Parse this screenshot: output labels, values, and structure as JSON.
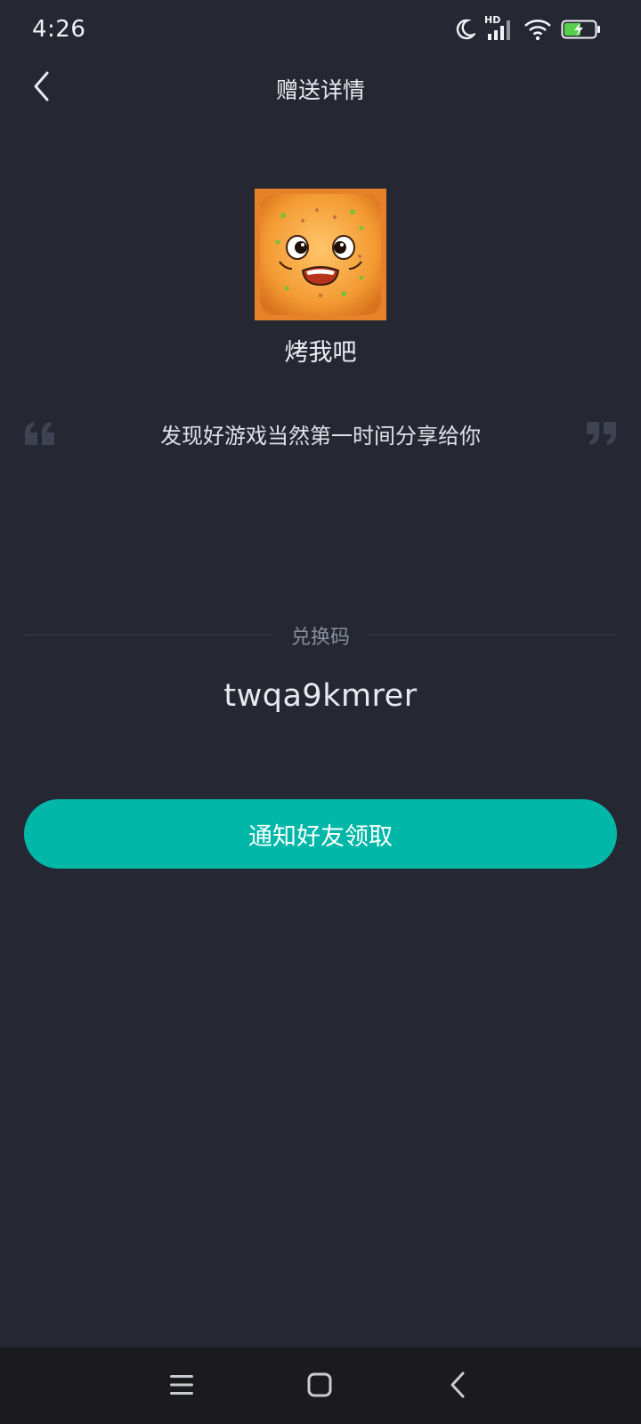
{
  "status_bar": {
    "time": "4:26",
    "network_label": "HD",
    "icons": [
      "moon-icon",
      "cellular-signal-icon",
      "wifi-icon",
      "battery-charging-icon"
    ],
    "battery_color": "#55d04a"
  },
  "header": {
    "title": "赠送详情",
    "back_icon": "chevron-left-icon"
  },
  "gift": {
    "game_name": "烤我吧",
    "message": "发现好游戏当然第一时间分享给你",
    "code_label": "兑换码",
    "code_value": "twqa9kmrer"
  },
  "actions": {
    "notify_label": "通知好友领取"
  },
  "nav_bar": {
    "icons": [
      "menu-icon",
      "home-square-icon",
      "back-chevron-icon"
    ]
  },
  "colors": {
    "background": "#252733",
    "accent": "#00b7a8",
    "nav_background": "#1b1b1e"
  }
}
